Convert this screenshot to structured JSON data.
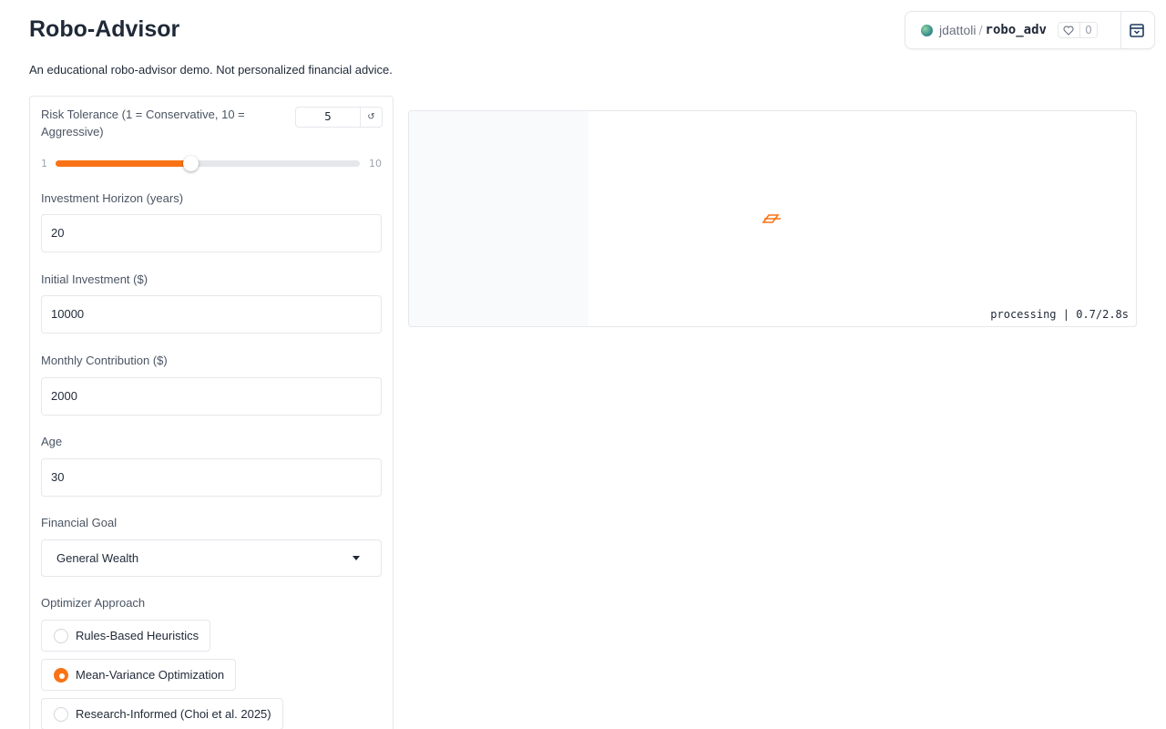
{
  "page": {
    "title": "Robo-Advisor",
    "subtitle": "An educational robo-advisor demo. Not personalized financial advice."
  },
  "space_header": {
    "user": "jdattoli",
    "separator": "/",
    "space_name": "robo_adv",
    "likes": "0",
    "icons": [
      "heart-icon",
      "calendar-icon"
    ]
  },
  "form": {
    "risk": {
      "label": "Risk Tolerance (1 = Conservative, 10 = Aggressive)",
      "value": "5",
      "min": "1",
      "max": "10",
      "fraction": 0.444,
      "reset_icon": "↺"
    },
    "horizon": {
      "label": "Investment Horizon (years)",
      "value": "20"
    },
    "initial": {
      "label": "Initial Investment ($)",
      "value": "10000"
    },
    "monthly": {
      "label": "Monthly Contribution ($)",
      "value": "2000"
    },
    "age": {
      "label": "Age",
      "value": "30"
    },
    "goal": {
      "label": "Financial Goal",
      "value": "General Wealth"
    },
    "optimizer": {
      "label": "Optimizer Approach",
      "options": [
        {
          "label": "Rules-Based Heuristics",
          "checked": false
        },
        {
          "label": "Mean-Variance Optimization",
          "checked": true
        },
        {
          "label": "Research-Informed (Choi et al. 2025)",
          "checked": false
        }
      ]
    }
  },
  "output": {
    "status": "processing | 0.7/2.8s"
  },
  "colors": {
    "accent": "#f97316",
    "border": "#e5e7eb",
    "text": "#1f2937"
  }
}
